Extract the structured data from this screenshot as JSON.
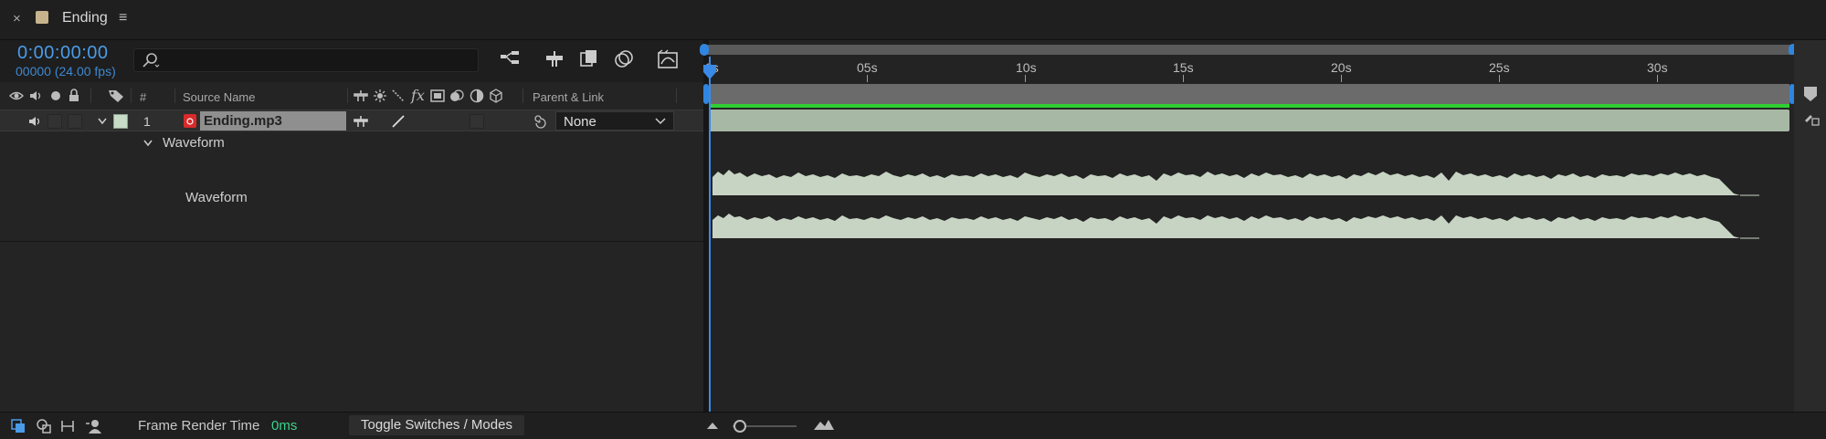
{
  "tab": {
    "title": "Ending",
    "close_glyph": "×",
    "menu_glyph": "≡",
    "swatch_color": "#c8b48c"
  },
  "header": {
    "timecode": "0:00:00:00",
    "frame_info": "00000 (24.00 fps)",
    "search_placeholder": ""
  },
  "columns": {
    "num": "#",
    "source_name": "Source Name",
    "fx_label": "fx",
    "parent_link": "Parent & Link"
  },
  "layer": {
    "number": "1",
    "name": "Ending.mp3",
    "label_color": "#c7dcc6",
    "parent": "None"
  },
  "properties": {
    "waveform_group": "Waveform",
    "waveform_item": "Waveform"
  },
  "ruler": {
    "ticks": [
      "0s",
      "05s",
      "10s",
      "15s",
      "20s",
      "25s",
      "30s"
    ]
  },
  "footer": {
    "frame_render_label": "Frame Render Time",
    "frame_render_value": "0ms",
    "toggle_label": "Toggle Switches / Modes"
  },
  "colors": {
    "accent": "#3a8ae8",
    "green": "#2fcf32",
    "waveform": "#c7d4c4"
  }
}
